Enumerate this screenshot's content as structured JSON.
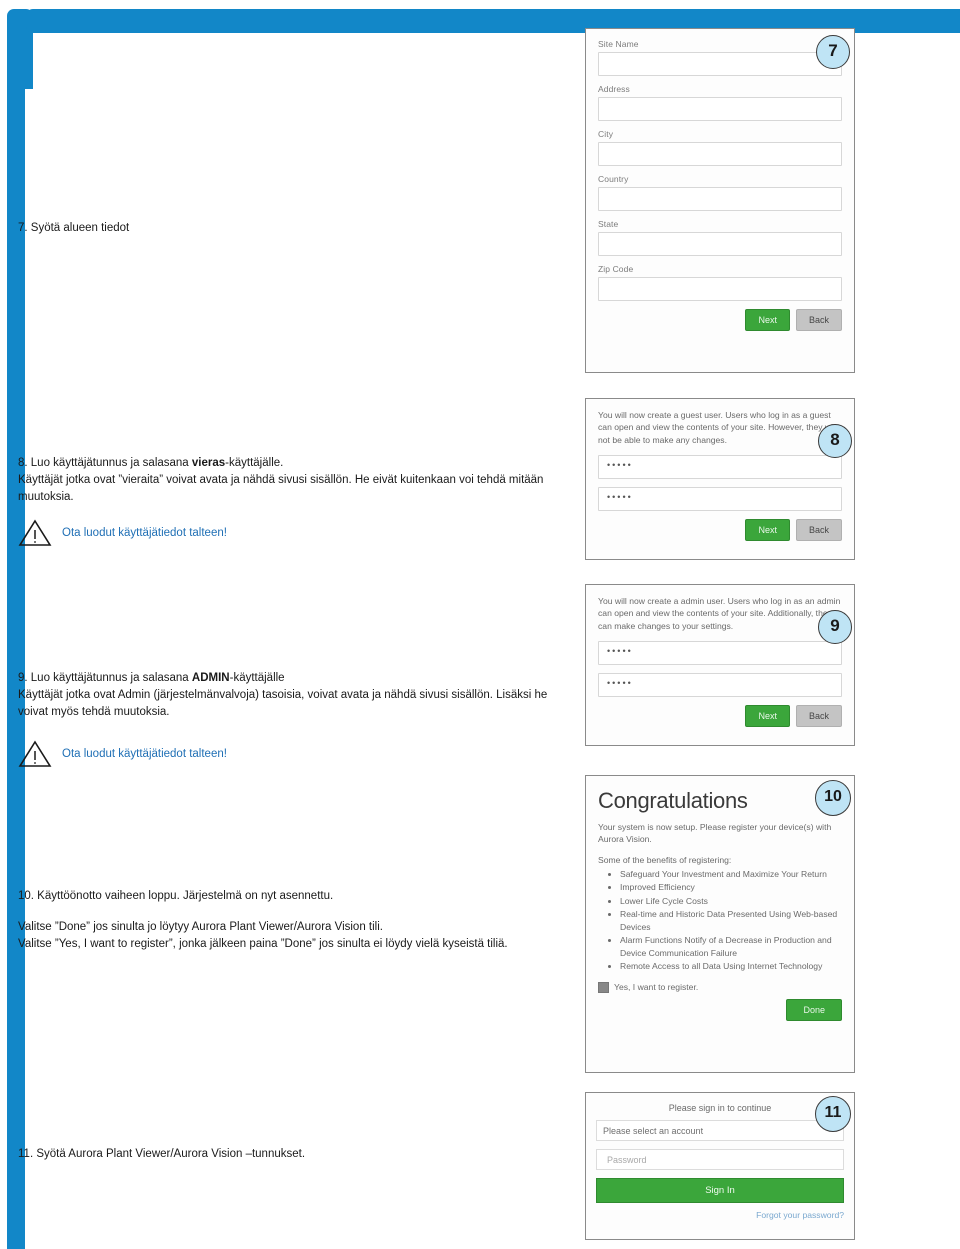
{
  "theme": {
    "accent": "#1287c8",
    "badge_fill": "#bfe4f5",
    "button_green": "#3ba63b",
    "link_blue": "#7aa8cf",
    "note_blue": "#1f6fb5"
  },
  "steps": {
    "s7": {
      "text": "7. Syötä alueen tiedot"
    },
    "s8": {
      "heading_pre": "8. Luo käyttäjätunnus ja salasana ",
      "heading_bold": "vieras",
      "heading_post": "-käyttäjälle.",
      "body": "Käyttäjät jotka ovat ”vieraita” voivat avata ja nähdä sivusi sisällön. He eivät kuitenkaan voi tehdä mitään muutoksia.",
      "note": "Ota luodut käyttäjätiedot talteen!"
    },
    "s9": {
      "heading_pre": "9. Luo käyttäjätunnus ja salasana ",
      "heading_bold": "ADMIN",
      "heading_post": "-käyttäjälle",
      "body": "Käyttäjät jotka ovat Admin (järjestelmänvalvoja) tasoisia, voivat avata ja nähdä sivusi sisällön. Lisäksi he voivat myös tehdä muutoksia.",
      "note": "Ota luodut käyttäjätiedot talteen!"
    },
    "s10": {
      "line1": "10. Käyttöönotto vaiheen loppu. Järjestelmä on nyt asennettu.",
      "line2": "Valitse ”Done” jos sinulta jo löytyy Aurora Plant Viewer/Aurora Vision tili.",
      "line3": "Valitse ”Yes, I want to register”, jonka jälkeen paina ”Done” jos sinulta ei löydy vielä kyseistä tiliä."
    },
    "s11": {
      "text": "11. Syötä Aurora Plant Viewer/Aurora Vision –tunnukset."
    }
  },
  "badges": {
    "b7": "7",
    "b8": "8",
    "b9": "9",
    "b10": "10",
    "b11": "11"
  },
  "panel_site": {
    "fields": [
      {
        "label": "Site Name"
      },
      {
        "label": "Address"
      },
      {
        "label": "City"
      },
      {
        "label": "Country"
      },
      {
        "label": "State"
      },
      {
        "label": "Zip Code"
      }
    ],
    "next_label": "Next",
    "back_label": "Back"
  },
  "panel_guest": {
    "paragraph": "You will now create a guest user. Users who log in as a guest can open and view the contents of your site. However, they will not be able to make any changes.",
    "username_value": "•••••",
    "password_value": "•••••",
    "next_label": "Next",
    "back_label": "Back"
  },
  "panel_admin": {
    "paragraph": "You will now create a admin user. Users who log in as an admin can open and view the contents of your site. Additionally, they can make changes to your settings.",
    "username_value": "•••••",
    "password_value": "•••••",
    "next_label": "Next",
    "back_label": "Back"
  },
  "panel_congrats": {
    "title": "Congratulations",
    "paragraph": "Your system is now setup. Please register your device(s) with Aurora Vision.",
    "benefits_intro": "Some of the benefits of registering:",
    "benefits": [
      "Safeguard Your Investment and Maximize Your Return",
      "Improved Efficiency",
      "Lower Life Cycle Costs",
      "Real-time and Historic Data Presented Using Web-based Devices",
      "Alarm Functions Notify of a Decrease in Production and Device Communication Failure",
      "Remote Access to all Data Using Internet Technology"
    ],
    "checkbox_label": "Yes, I want to register.",
    "done_label": "Done"
  },
  "panel_signin": {
    "title": "Please sign in to continue",
    "account_value": "Please select an account",
    "password_placeholder": "Password",
    "signin_label": "Sign In",
    "forgot_label": "Forgot your password?"
  }
}
